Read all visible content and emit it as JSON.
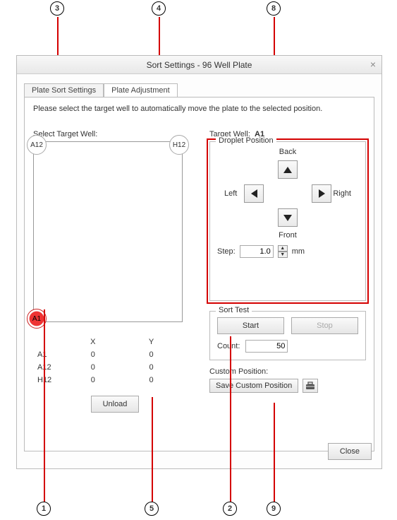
{
  "dialog": {
    "title": "Sort Settings - 96 Well Plate",
    "close_icon": "×"
  },
  "tabs": {
    "settings": "Plate Sort Settings",
    "adjust": "Plate Adjustment"
  },
  "instruction": "Please select the target well to automatically move the plate to the selected position.",
  "left": {
    "label": "Select Target Well:",
    "well_a12": "A12",
    "well_h12": "H12",
    "well_a1": "A1",
    "coord_header_x": "X",
    "coord_header_y": "Y",
    "rows": [
      {
        "name": "A1",
        "x": "0",
        "y": "0"
      },
      {
        "name": "A12",
        "x": "0",
        "y": "0"
      },
      {
        "name": "H12",
        "x": "0",
        "y": "0"
      }
    ],
    "unload": "Unload"
  },
  "right": {
    "target_label": "Target Well:",
    "target_value": "A1",
    "droplet": {
      "legend": "Droplet Position",
      "back": "Back",
      "front": "Front",
      "left": "Left",
      "right": "Right",
      "step_label": "Step:",
      "step_value": "1.0",
      "step_unit": "mm"
    },
    "sorttest": {
      "legend": "Sort Test",
      "start": "Start",
      "stop": "Stop",
      "count_label": "Count:",
      "count_value": "50"
    },
    "custom": {
      "label": "Custom Position:",
      "save": "Save Custom Position"
    }
  },
  "close_button": "Close",
  "callouts": {
    "c1": "1",
    "c2": "2",
    "c3": "3",
    "c4": "4",
    "c5": "5",
    "c8": "8",
    "c9": "9"
  }
}
